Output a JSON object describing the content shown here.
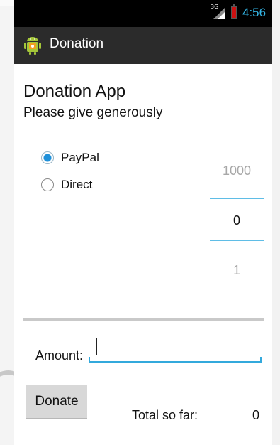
{
  "status_bar": {
    "network_label": "3G",
    "time": "4:56",
    "time_color": "#33b5e5",
    "battery_color": "#cc1111"
  },
  "action_bar": {
    "icon": "android-app-icon",
    "title": "Donation",
    "background": "#2b2b2b"
  },
  "main": {
    "heading": "Donation App",
    "subheading": "Please give generously",
    "payment_methods": [
      {
        "label": "PayPal",
        "checked": true
      },
      {
        "label": "Direct",
        "checked": false
      }
    ],
    "amount_picker": {
      "previous": "1000",
      "current": "0",
      "next": "1"
    },
    "progress": {
      "value": 0
    },
    "amount_field": {
      "label": "Amount:",
      "value": ""
    },
    "donate_button": "Donate",
    "total_label": "Total so far:",
    "total_value": "0"
  },
  "colors": {
    "accent": "#33b5e5",
    "radio_checked": "#1f90d9",
    "button_bg": "#d8d8d8",
    "separator": "#c9c9c9"
  }
}
